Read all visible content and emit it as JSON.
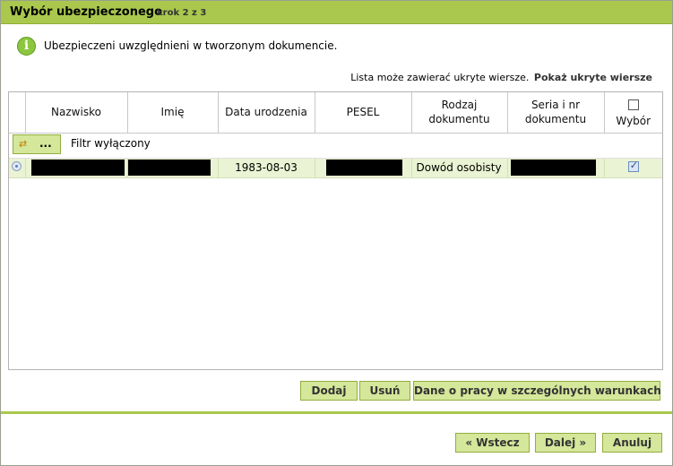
{
  "header": {
    "title": "Wybór ubezpieczonego",
    "step": "krok 2 z 3",
    "accent_color": "#a9c84d"
  },
  "info": {
    "icon": "info-icon",
    "message": "Ubezpieczeni uwzględnieni w tworzonym dokumencie."
  },
  "hidden_rows": {
    "text": "Lista może zawierać ukryte wiersze.",
    "link": "Pokaż ukryte wiersze"
  },
  "table": {
    "columns": [
      "Nazwisko",
      "Imię",
      "Data urodzenia",
      "PESEL",
      "Rodzaj dokumentu",
      "Seria i nr dokumentu",
      "Wybór"
    ],
    "filter": {
      "button_label": "...",
      "icon": "filter-arrows-icon",
      "status": "Filtr wyłączony"
    },
    "rows": [
      {
        "birth_date": "1983-08-03",
        "document_type": "Dowód osobisty",
        "selected": true
      }
    ]
  },
  "table_actions": {
    "add": "Dodaj",
    "remove": "Usuń",
    "special_conditions": "Dane o pracy w szczególnych warunkach"
  },
  "navigation": {
    "back": "« Wstecz",
    "next": "Dalej »",
    "cancel": "Anuluj"
  }
}
